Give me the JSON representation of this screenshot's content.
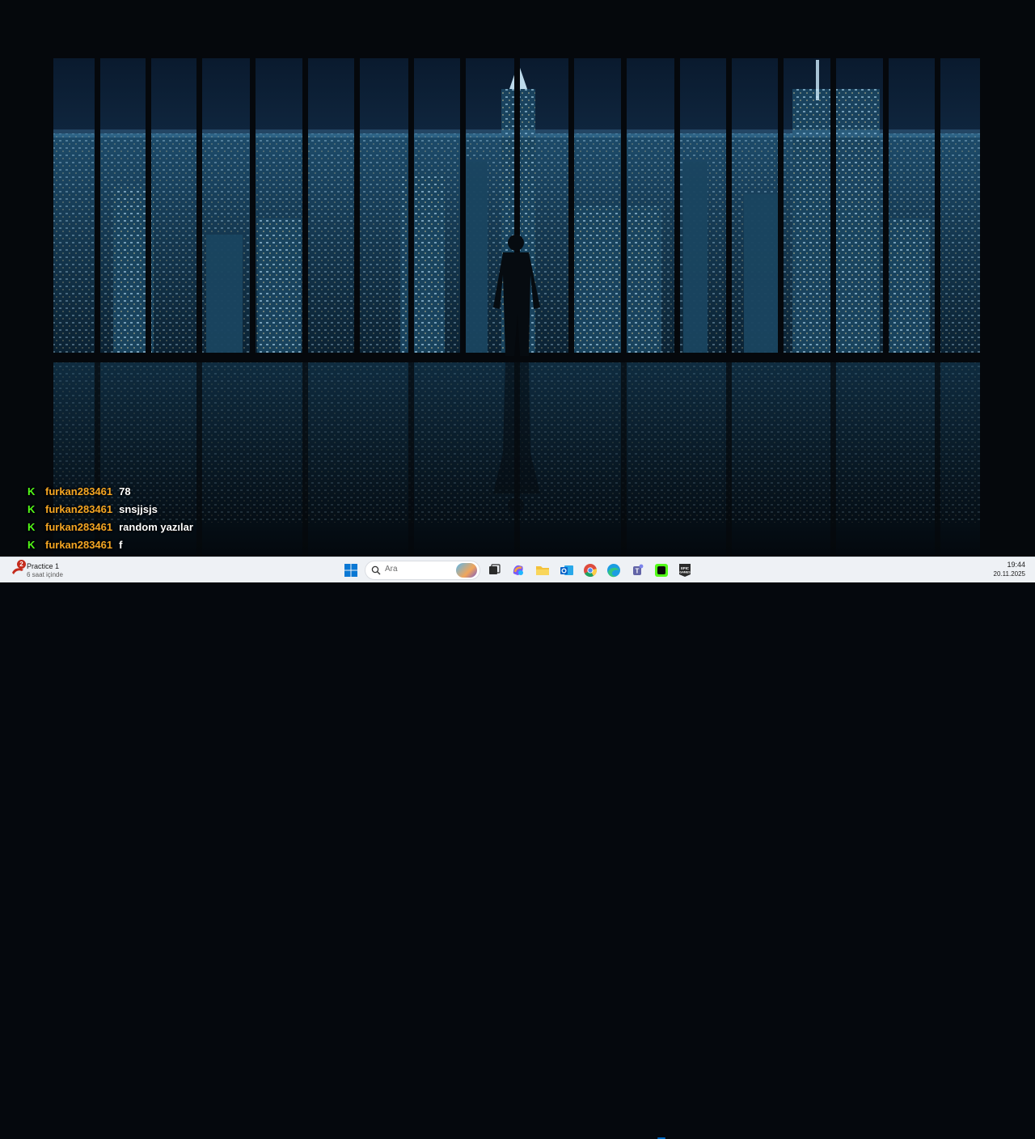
{
  "chat": {
    "messages": [
      {
        "badge": "K",
        "user": "furkan283461",
        "text": "78"
      },
      {
        "badge": "K",
        "user": "furkan283461",
        "text": "snsjjsjs"
      },
      {
        "badge": "K",
        "user": "furkan283461",
        "text": "random yazılar"
      },
      {
        "badge": "K",
        "user": "furkan283461",
        "text": "f"
      }
    ]
  },
  "taskbar": {
    "widget": {
      "badge": "2",
      "title": "Practice 1",
      "subtitle": "6 saat içinde"
    },
    "search": {
      "placeholder": "Ara"
    },
    "apps": [
      {
        "name": "task-view-icon"
      },
      {
        "name": "copilot-icon"
      },
      {
        "name": "file-explorer-icon"
      },
      {
        "name": "outlook-icon"
      },
      {
        "name": "chrome-icon"
      },
      {
        "name": "edge-icon"
      },
      {
        "name": "teams-icon"
      },
      {
        "name": "kick-icon",
        "active": true
      },
      {
        "name": "epic-games-icon",
        "label": "EPIC GAMES"
      }
    ],
    "clock": {
      "time": "19:44",
      "date": "20.11.2025"
    }
  },
  "colors": {
    "taskbar_bg": "#eef1f5",
    "chat_user": "#f5a623",
    "chat_badge": "#53fc18",
    "accent": "#0067c0"
  }
}
